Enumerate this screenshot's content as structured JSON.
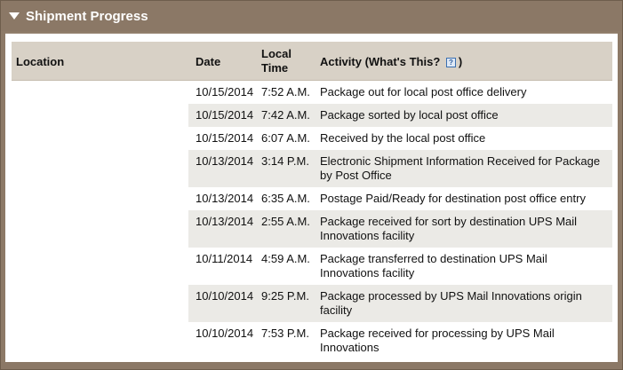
{
  "section": {
    "title": "Shipment Progress"
  },
  "table": {
    "headers": {
      "location": "Location",
      "date": "Date",
      "time": "Local Time",
      "time_line1": "Local",
      "time_line2": "Time",
      "activity": "Activity (What's This?",
      "activity_close": ")",
      "help_icon": "?"
    },
    "rows": [
      {
        "date": "10/15/2014",
        "time": "7:52 A.M.",
        "activity": "Package out for local post office delivery"
      },
      {
        "date": "10/15/2014",
        "time": "7:42 A.M.",
        "activity": "Package sorted by local post office"
      },
      {
        "date": "10/15/2014",
        "time": "6:07 A.M.",
        "activity": "Received by the local post office"
      },
      {
        "date": "10/13/2014",
        "time": "3:14 P.M.",
        "activity": "Electronic Shipment Information Received for Package by Post Office"
      },
      {
        "date": "10/13/2014",
        "time": "6:35 A.M.",
        "activity": "Postage Paid/Ready for destination post office entry"
      },
      {
        "date": "10/13/2014",
        "time": "2:55 A.M.",
        "activity": "Package received for sort by destination UPS Mail Innovations facility"
      },
      {
        "date": "10/11/2014",
        "time": "4:59 A.M.",
        "activity": "Package transferred to destination UPS Mail Innovations facility"
      },
      {
        "date": "10/10/2014",
        "time": "9:25 P.M.",
        "activity": "Package processed by UPS Mail Innovations origin facility"
      },
      {
        "date": "10/10/2014",
        "time": "7:53 P.M.",
        "activity": "Package received for processing by UPS Mail Innovations"
      }
    ]
  },
  "colors": {
    "frame": "#8b7866",
    "header_bg": "#d8d1c6",
    "alt_row": "#ebeae6"
  }
}
